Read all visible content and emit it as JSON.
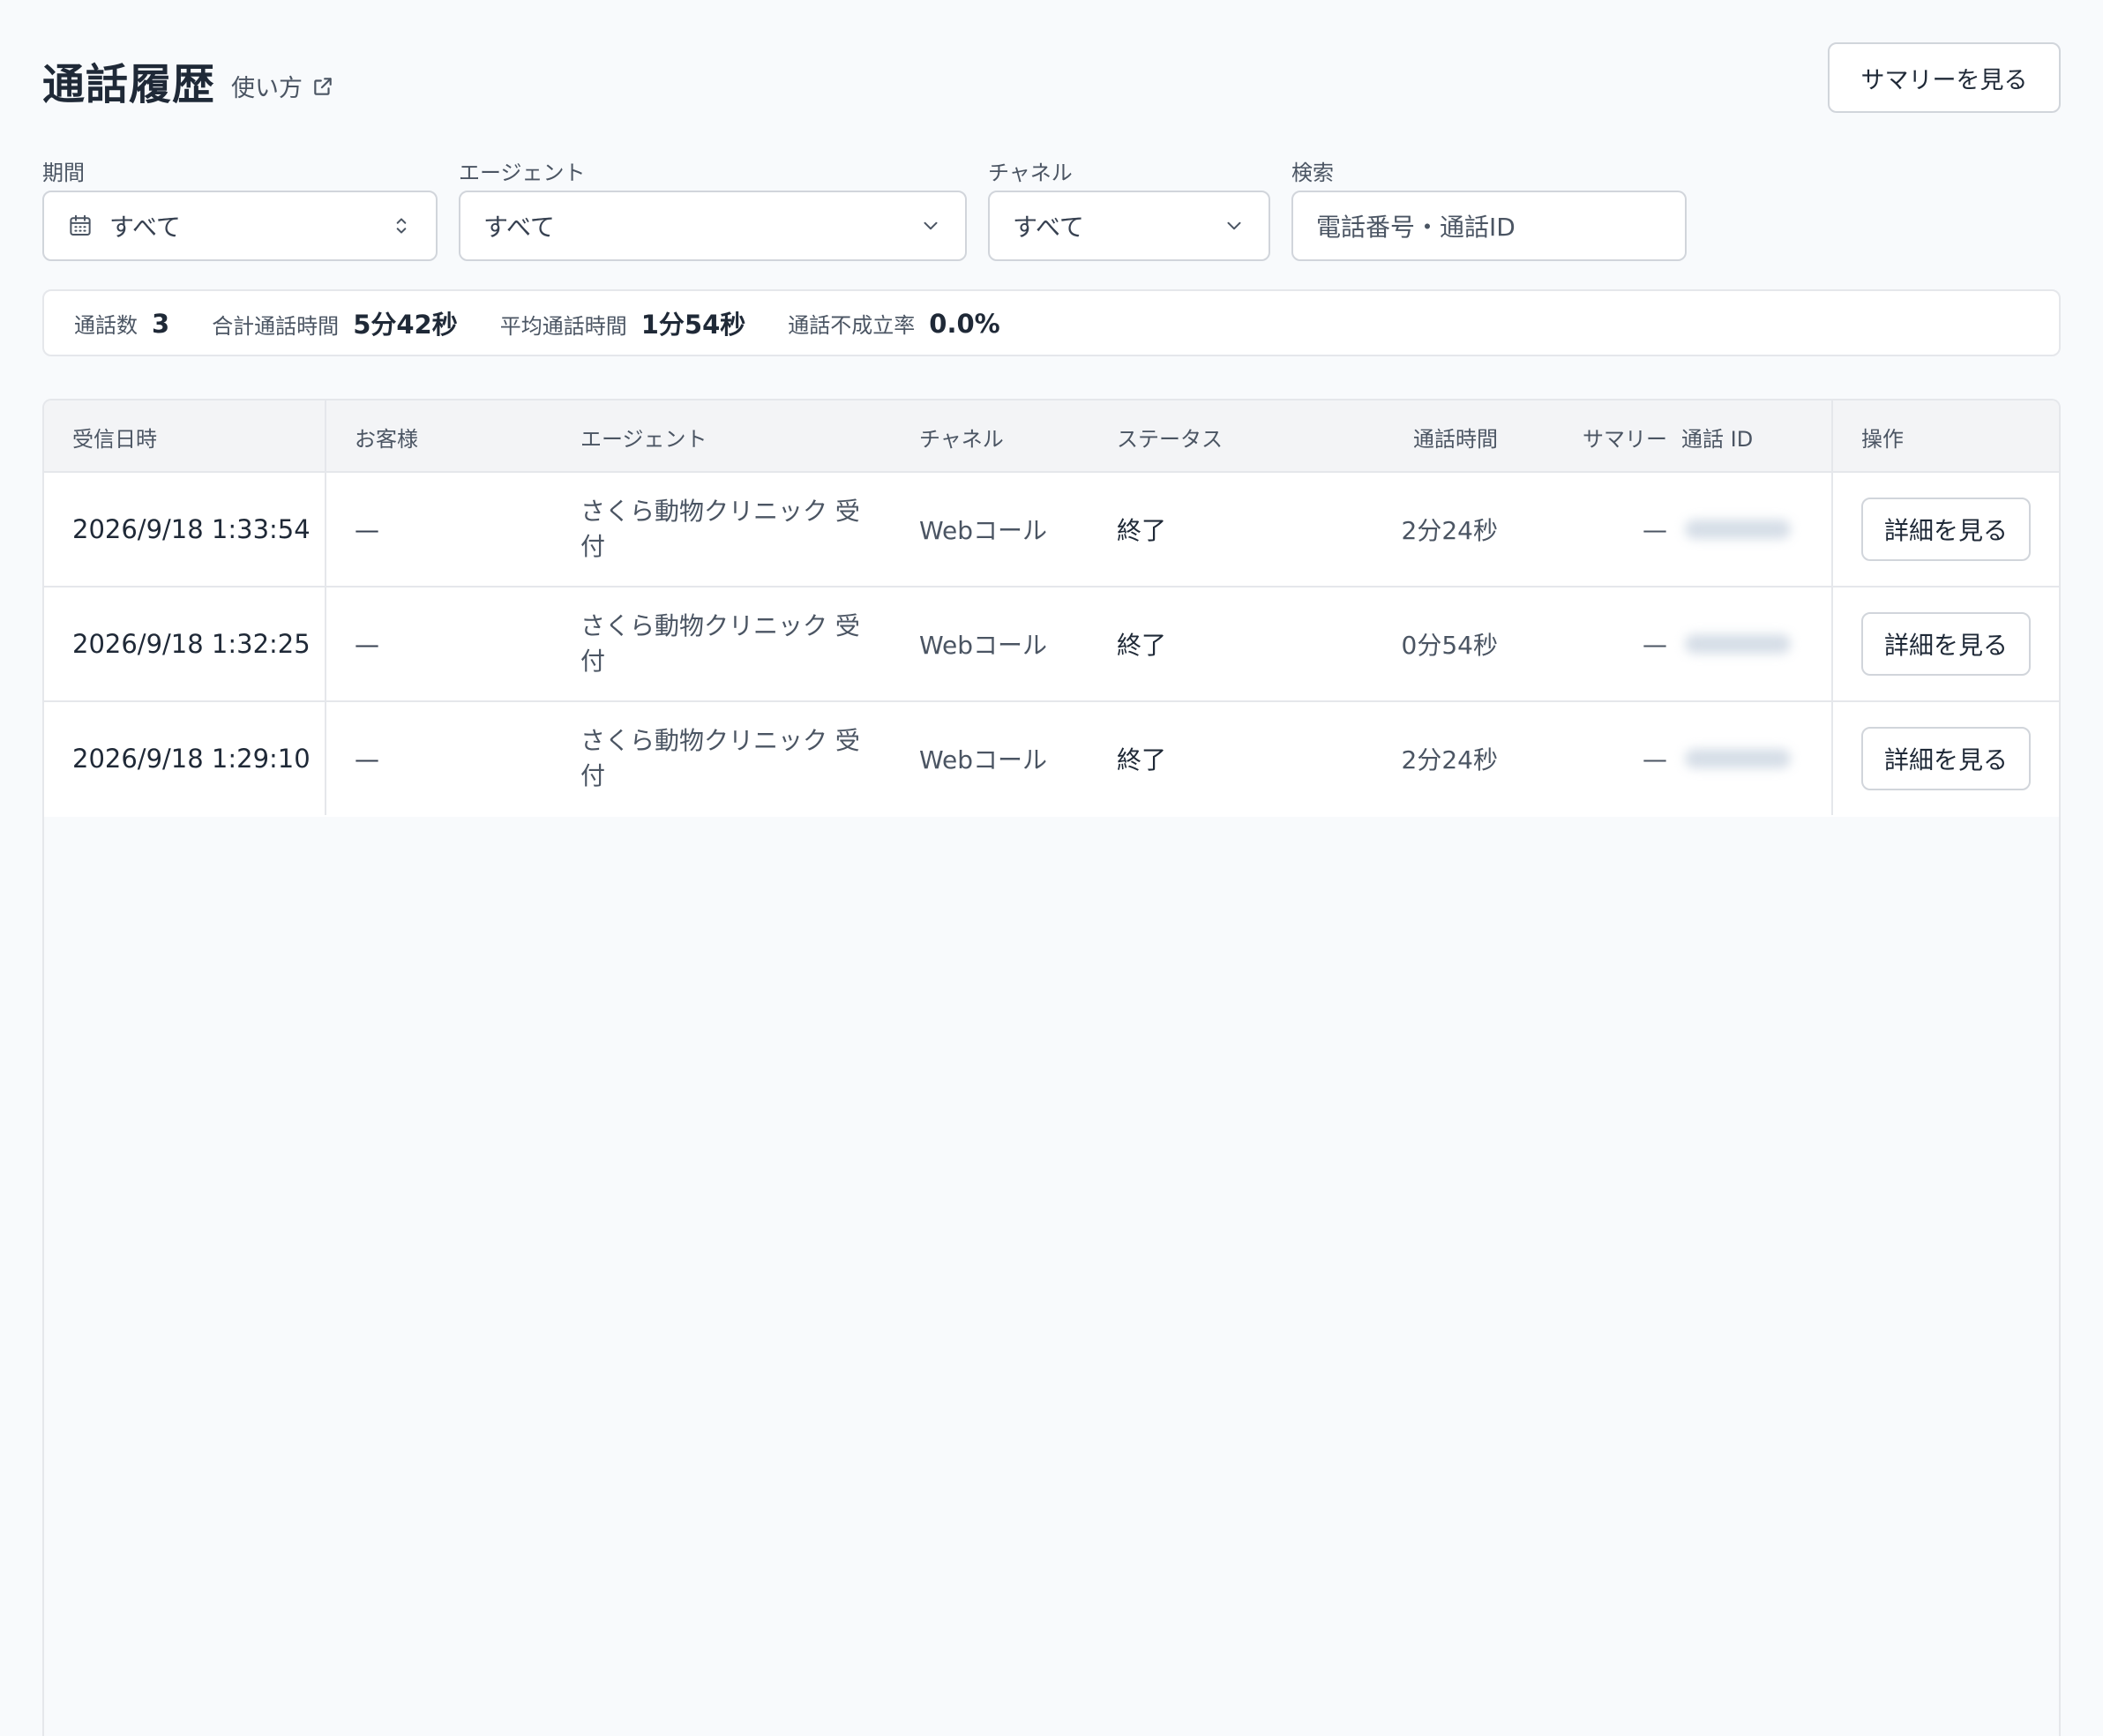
{
  "header": {
    "title": "通話履歴",
    "help_label": "使い方",
    "summary_button": "サマリーを見る"
  },
  "filters": {
    "period": {
      "label": "期間",
      "value": "すべて"
    },
    "agent": {
      "label": "エージェント",
      "value": "すべて"
    },
    "channel": {
      "label": "チャネル",
      "value": "すべて"
    },
    "search": {
      "label": "検索",
      "placeholder": "電話番号・通話ID"
    }
  },
  "stats": [
    {
      "label": "通話数",
      "value": "3"
    },
    {
      "label": "合計通話時間",
      "value": "5分42秒"
    },
    {
      "label": "平均通話時間",
      "value": "1分54秒"
    },
    {
      "label": "通話不成立率",
      "value": "0.0%"
    }
  ],
  "table": {
    "columns": {
      "datetime": "受信日時",
      "customer": "お客様",
      "agent": "エージェント",
      "channel": "チャネル",
      "status": "ステータス",
      "duration": "通話時間",
      "summary": "サマリー",
      "call_id": "通話 ID",
      "actions": "操作"
    },
    "rows": [
      {
        "datetime": "2026/9/18 1:33:54",
        "customer": "—",
        "agent": "さくら動物クリニック 受付",
        "channel": "Webコール",
        "status": "終了",
        "duration": "2分24秒",
        "summary": "—",
        "detail_button": "詳細を見る"
      },
      {
        "datetime": "2026/9/18 1:32:25",
        "customer": "—",
        "agent": "さくら動物クリニック 受付",
        "channel": "Webコール",
        "status": "終了",
        "duration": "0分54秒",
        "summary": "—",
        "detail_button": "詳細を見る"
      },
      {
        "datetime": "2026/9/18 1:29:10",
        "customer": "—",
        "agent": "さくら動物クリニック 受付",
        "channel": "Webコール",
        "status": "終了",
        "duration": "2分24秒",
        "summary": "—",
        "detail_button": "詳細を見る"
      }
    ]
  },
  "icons": {
    "external_link": "external-link-icon",
    "calendar": "calendar-icon",
    "updown": "chevron-up-down-icon",
    "chevron_down": "chevron-down-icon"
  }
}
